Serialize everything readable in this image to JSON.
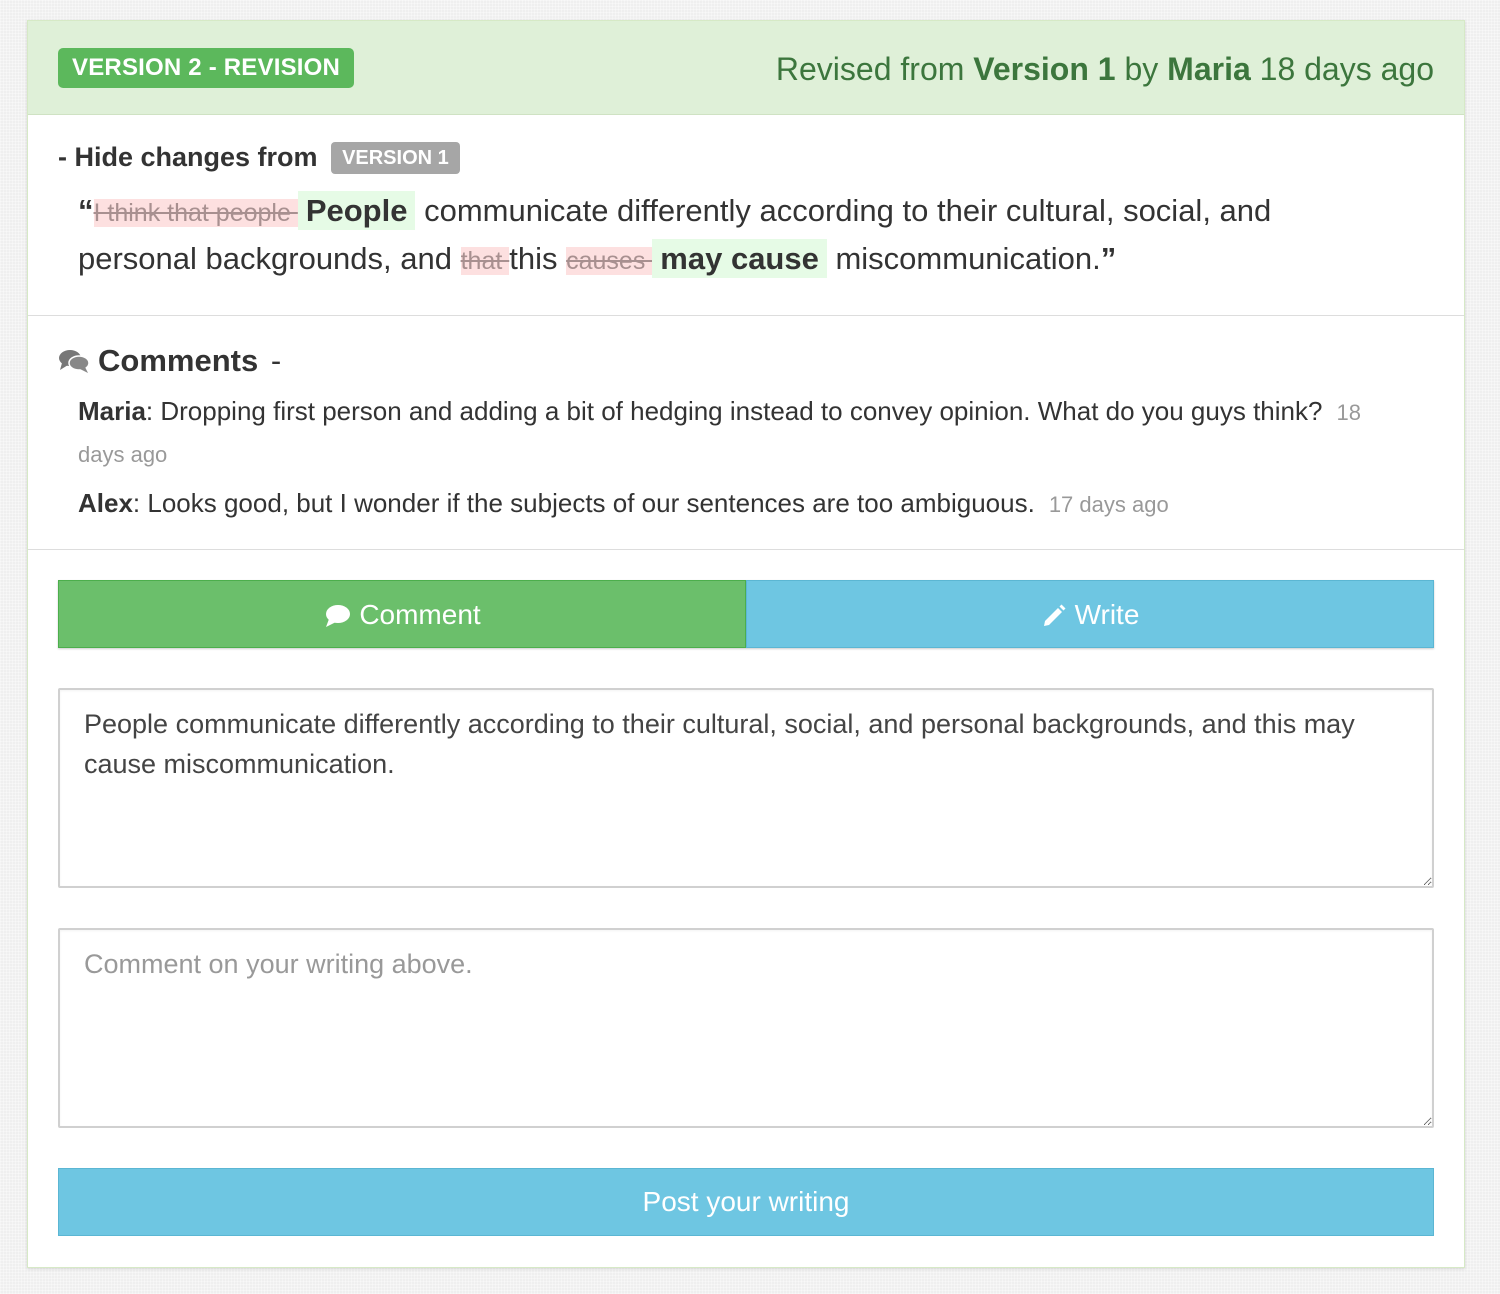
{
  "header": {
    "version_badge": "VERSION 2 - REVISION",
    "revised_prefix": "Revised from",
    "revised_version": "Version 1",
    "revised_by": "by",
    "revised_author": "Maria",
    "revised_time": "18 days ago"
  },
  "changes": {
    "toggle_label": "- Hide changes from",
    "from_badge": "VERSION 1",
    "open_quote": "“",
    "close_quote": "”",
    "segments": {
      "del_1": "I think that people ",
      "ins_1": "People",
      "plain_1": " communicate differently according to their cultural, social, and personal backgrounds, and ",
      "del_2": "that ",
      "plain_2": "this ",
      "del_3": "causes ",
      "ins_2": "may cause",
      "plain_3": " miscommunication."
    }
  },
  "comments": {
    "title": "Comments",
    "toggle": "-",
    "items": [
      {
        "author": "Maria",
        "text": ": Dropping first person and adding a bit of hedging instead to convey opinion. What do you guys think?",
        "time": "18 days ago"
      },
      {
        "author": "Alex",
        "text": ": Looks good, but I wonder if the subjects of our sentences are too ambiguous.",
        "time": "17 days ago"
      }
    ]
  },
  "tabs": {
    "comment_label": "Comment",
    "write_label": "Write"
  },
  "writing_input": {
    "value": "People communicate differently according to their cultural, social, and personal backgrounds, and this may cause miscommunication."
  },
  "comment_input": {
    "placeholder": "Comment on your writing above.",
    "value": ""
  },
  "post_button": {
    "label": "Post your writing"
  },
  "colors": {
    "success": "#5cb85c",
    "success_bg": "#dff0d8",
    "success_text": "#3c763d",
    "info": "#6ec6e2",
    "deleted_bg": "#fde0e0",
    "inserted_bg": "#e6fbe6"
  },
  "icons": {
    "comments_header": "comments-icon",
    "comment_tab": "comment-icon",
    "write_tab": "pencil-icon"
  }
}
